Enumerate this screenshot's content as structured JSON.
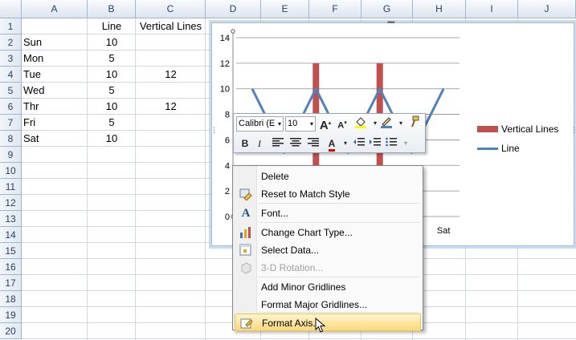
{
  "columns": [
    "A",
    "B",
    "C",
    "D",
    "E",
    "F",
    "G",
    "H",
    "I",
    "J"
  ],
  "rows": [
    "1",
    "2",
    "3",
    "4",
    "5",
    "6",
    "7",
    "8",
    "9",
    "10",
    "11",
    "12",
    "13",
    "14",
    "15",
    "16",
    "17",
    "18",
    "19",
    "20"
  ],
  "cells": {
    "B1": "Line",
    "C1": "Vertical Lines",
    "A2": "Sun",
    "B2": "10",
    "A3": "Mon",
    "B3": "5",
    "A4": "Tue",
    "B4": "10",
    "C4": "12",
    "A5": "Wed",
    "B5": "5",
    "A6": "Thr",
    "B6": "10",
    "C6": "12",
    "A7": "Fri",
    "B7": "5",
    "A8": "Sat",
    "B8": "10"
  },
  "chart_data": {
    "type": "line",
    "categories": [
      "Sun",
      "Mon",
      "Tue",
      "Wed",
      "Thr",
      "Fri",
      "Sat"
    ],
    "visible_x_tick": "Sat",
    "yticks": [
      "0",
      "2",
      "4",
      "6",
      "8",
      "10",
      "12",
      "14"
    ],
    "ylim": [
      0,
      14
    ],
    "series": [
      {
        "name": "Line",
        "type": "line",
        "color": "#4f81bd",
        "values": [
          10,
          5,
          10,
          5,
          10,
          5,
          10
        ]
      },
      {
        "name": "Vertical Lines",
        "type": "bar",
        "color": "#c0504d",
        "values": [
          null,
          null,
          12,
          null,
          12,
          null,
          null
        ]
      }
    ],
    "legend_position": "right",
    "legend": [
      "Vertical Lines",
      "Line"
    ]
  },
  "minibar": {
    "font_name": "Calibri (E",
    "font_size": "10",
    "grow_font": "A",
    "shrink_font": "A",
    "bold": "B",
    "italic": "I",
    "font_color_glyph": "A"
  },
  "menu": {
    "items": [
      {
        "label": "Delete",
        "icon": "none"
      },
      {
        "label": "Reset to Match Style",
        "icon": "reset-style-icon"
      },
      {
        "label": "Font...",
        "icon": "font-icon"
      },
      {
        "label": "Change Chart Type...",
        "icon": "chart-type-icon"
      },
      {
        "label": "Select Data...",
        "icon": "select-data-icon"
      },
      {
        "label": "3-D Rotation...",
        "icon": "rotation-icon",
        "disabled": true
      },
      {
        "label": "Add Minor Gridlines",
        "icon": "none"
      },
      {
        "label": "Format Major Gridlines...",
        "icon": "none"
      },
      {
        "label": "Format Axis...",
        "icon": "format-axis-icon",
        "highlighted": true
      }
    ]
  },
  "colors": {
    "bar": "#c0504d",
    "line": "#4f81bd",
    "menu_highlight": "#fdd87c",
    "header_text": "#27416a"
  }
}
